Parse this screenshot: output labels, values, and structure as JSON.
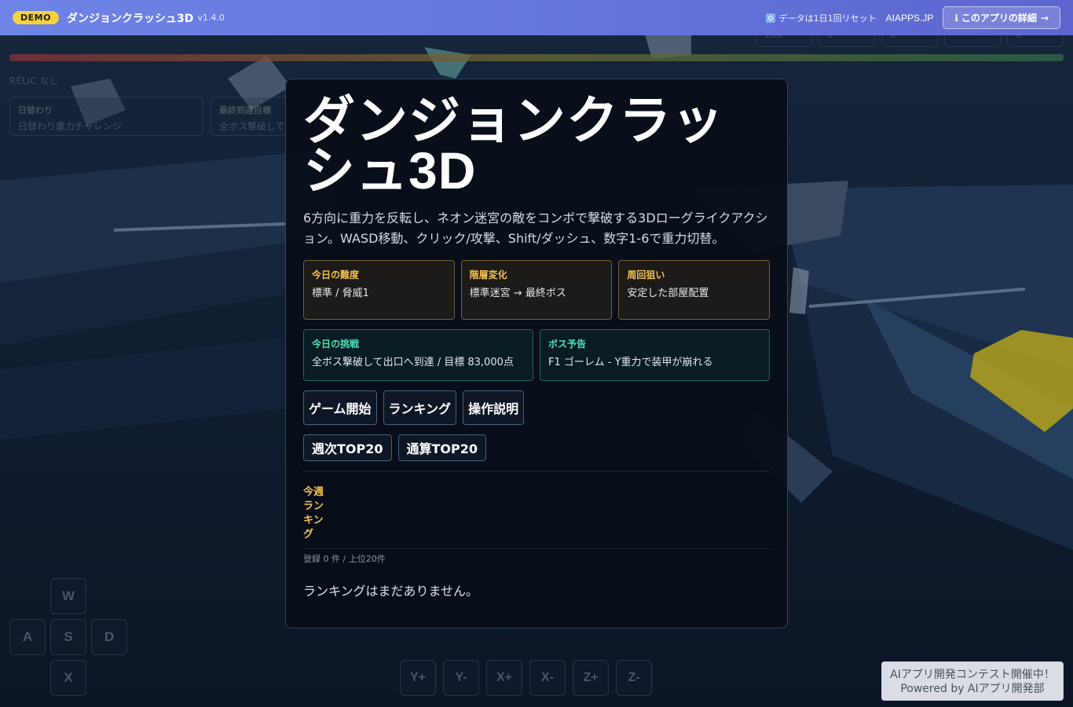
{
  "topbar": {
    "demo_badge": "DEMO",
    "app_title": "ダンジョンクラッシュ3D",
    "version": "v1.4.0",
    "reset_note": "データは1日1回リセット",
    "site_link": "AIAPPS.JP",
    "detail_button": "このアプリの詳細",
    "detail_icon": "info-icon",
    "detail_arrow": "→"
  },
  "background_hud": {
    "relic_label": "RELIC なし",
    "cards": [
      {
        "title": "日替わり",
        "value": "日替わり重力チャレンジ"
      },
      {
        "title": "最終到達目標",
        "value": "全ボス撃破して出口へ"
      }
    ],
    "stats": [
      "100",
      "0",
      "0",
      "",
      "0"
    ],
    "keys": [
      "W",
      "A",
      "S",
      "D",
      "X"
    ],
    "gravity_keys": [
      "Y+",
      "Y-",
      "X+",
      "X-",
      "Z+",
      "Z-"
    ]
  },
  "modal": {
    "title": "ダンジョンクラッシュ3D",
    "description": "6方向に重力を反転し、ネオン迷宮の敵をコンボで撃破する3Dローグライクアクション。WASD移動、クリック/攻撃、Shift/ダッシュ、数字1-6で重力切替。",
    "info_cards": [
      {
        "label": "今日の難度",
        "value": "標準 / 脅威1"
      },
      {
        "label": "階層変化",
        "value": "標準迷宮 → 最終ボス"
      },
      {
        "label": "周回狙い",
        "value": "安定した部屋配置"
      }
    ],
    "challenge_cards": [
      {
        "label": "今日の挑戦",
        "value": "全ボス撃破して出口へ到達 / 目標 83,000点"
      },
      {
        "label": "ボス予告",
        "value": "F1 ゴーレム - Y重力で装甲が崩れる"
      }
    ],
    "buttons": {
      "start": "ゲーム開始",
      "ranking": "ランキング",
      "howto": "操作説明",
      "weekly": "週次TOP20",
      "alltime": "通算TOP20"
    },
    "ranking": {
      "title": "今週ランキング",
      "count": "登録 0 件 / 上位20件",
      "empty": "ランキングはまだありません。"
    }
  },
  "contest": {
    "line1": "AIアプリ開発コンテスト開催中！",
    "line2": "Powered by AIアプリ開発部"
  },
  "colors": {
    "topbar_start": "#6e84e6",
    "topbar_end": "#5c66cf",
    "gold_accent": "#f2c14e",
    "teal_accent": "#4fe0b5",
    "demo_badge": "#f7d13d"
  }
}
